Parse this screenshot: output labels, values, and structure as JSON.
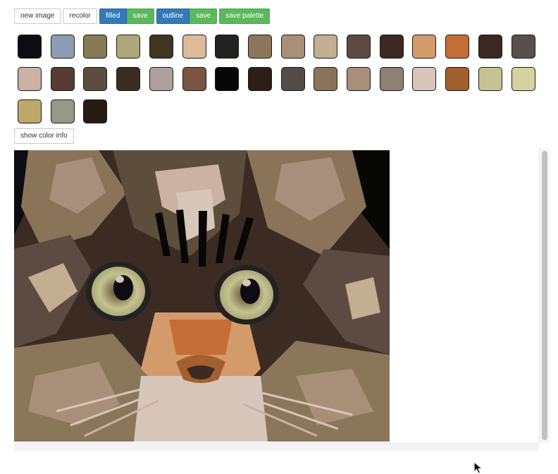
{
  "toolbar": {
    "new_image_label": "new image",
    "recolor_label": "recolor",
    "filled_label": "filled",
    "filled_save_label": "save",
    "outline_label": "outline",
    "outline_save_label": "save",
    "save_palette_label": "save palette"
  },
  "palette": {
    "colors": [
      "#0d0c12",
      "#8c9db5",
      "#857a55",
      "#ada77a",
      "#3f3520",
      "#deb99a",
      "#222220",
      "#8a7659",
      "#a88f78",
      "#c2ae91",
      "#5d4a40",
      "#3c2a22",
      "#d49b6a",
      "#c56d37",
      "#3a2822",
      "#58504f",
      "#cbb2a3",
      "#573c32",
      "#5c4d3c",
      "#3b2b22",
      "#ada09f",
      "#7b5443",
      "#070706",
      "#2c2016",
      "#544c4b",
      "#8a7459",
      "#a88f7b",
      "#8c8172",
      "#d8c6bb",
      "#a3602f",
      "#c5c391",
      "#d4d29f",
      "#bea76a",
      "#979985",
      "#261b12"
    ]
  },
  "info": {
    "show_color_info_label": "show color info"
  },
  "canvas": {
    "background": "#1b1612"
  }
}
